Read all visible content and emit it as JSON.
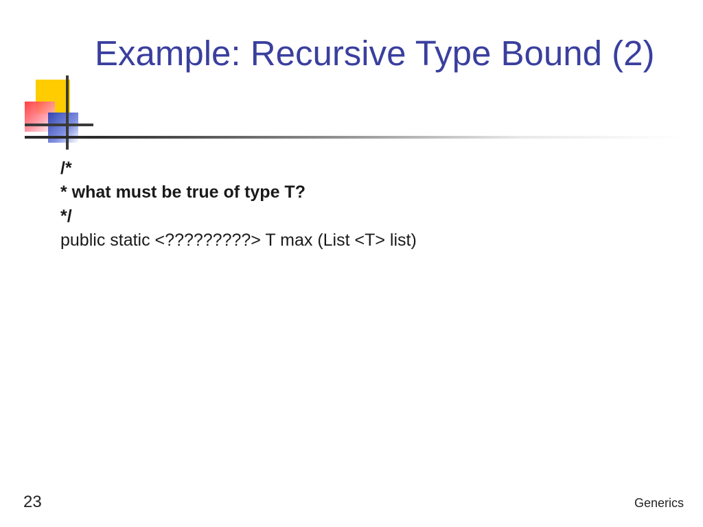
{
  "title": "Example: Recursive Type Bound (2)",
  "content": {
    "comment_open": "/*",
    "comment_line": " * what must be true of type T?",
    "comment_close": " */",
    "code_line": "public  static <?????????>  T  max (List <T> list)"
  },
  "page_number": "23",
  "footer": "Generics"
}
